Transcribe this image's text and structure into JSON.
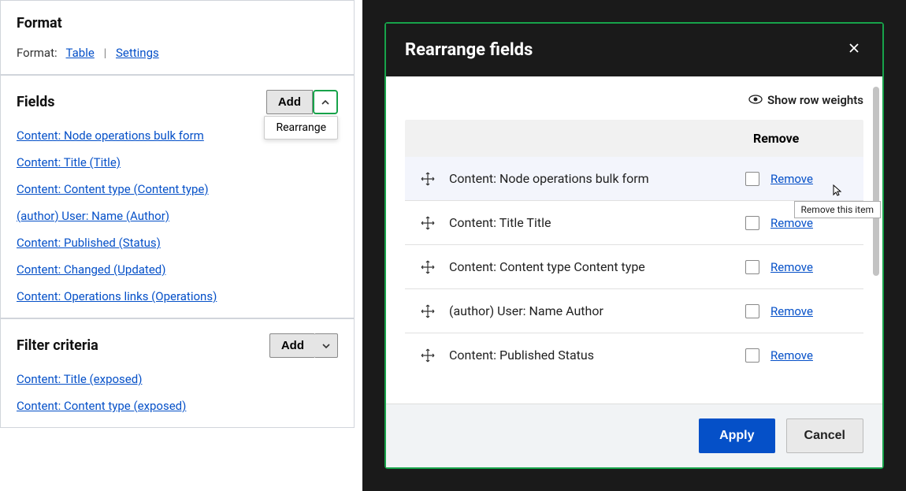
{
  "left": {
    "format": {
      "title": "Format",
      "label": "Format:",
      "table_link": "Table",
      "settings_link": "Settings"
    },
    "fields": {
      "title": "Fields",
      "add_label": "Add",
      "dropdown_item": "Rearrange",
      "items": [
        "Content: Node operations bulk form",
        "Content: Title (Title)",
        "Content: Content type (Content type)",
        "(author) User: Name (Author)",
        "Content: Published (Status)",
        "Content: Changed (Updated)",
        "Content: Operations links (Operations)"
      ]
    },
    "filter": {
      "title": "Filter criteria",
      "add_label": "Add",
      "items": [
        "Content: Title (exposed)",
        "Content: Content type (exposed)"
      ]
    }
  },
  "modal": {
    "title": "Rearrange fields",
    "show_weights": "Show row weights",
    "col_remove": "Remove",
    "rows": [
      {
        "label": "Content: Node operations bulk form",
        "remove": "Remove"
      },
      {
        "label": "Content: Title Title",
        "remove": "Remove"
      },
      {
        "label": "Content: Content type Content type",
        "remove": "Remove"
      },
      {
        "label": "(author) User: Name Author",
        "remove": "Remove"
      },
      {
        "label": "Content: Published Status",
        "remove": "Remove"
      }
    ],
    "apply": "Apply",
    "cancel": "Cancel",
    "tooltip": "Remove this item"
  }
}
